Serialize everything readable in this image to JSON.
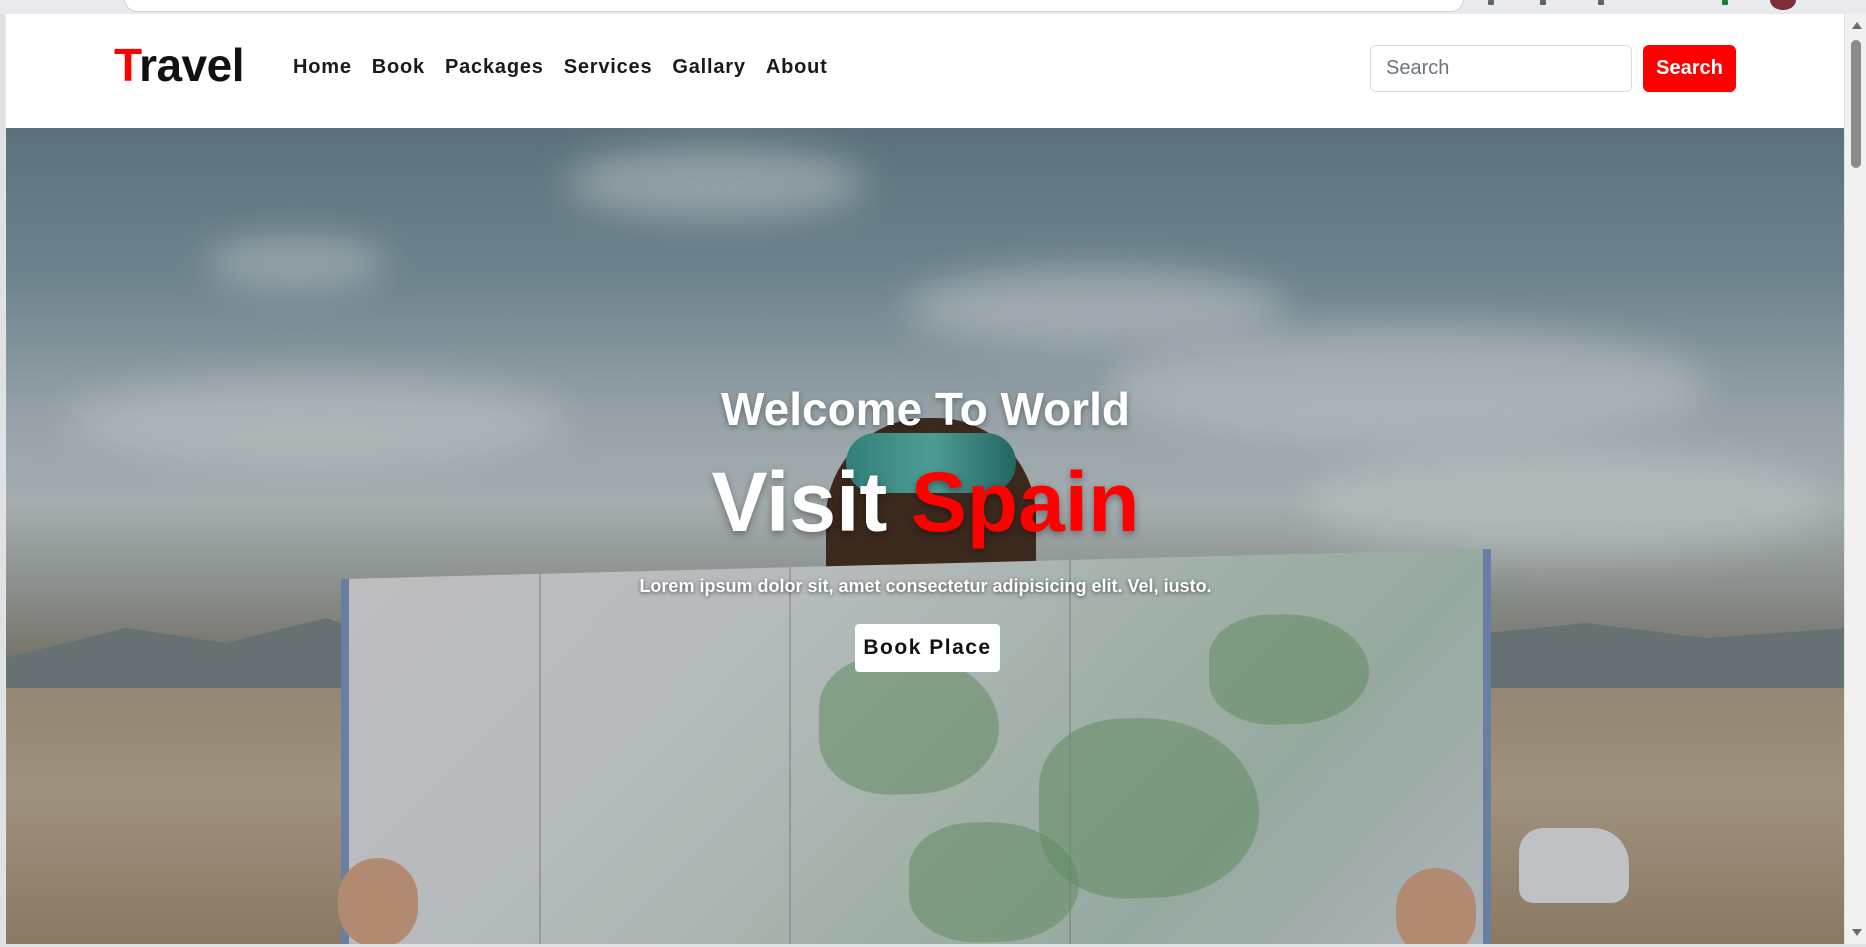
{
  "navbar": {
    "brand_first_letter": "T",
    "brand_rest": "ravel",
    "links": [
      "Home",
      "Book",
      "Packages",
      "Services",
      "Gallary",
      "About"
    ],
    "search": {
      "placeholder": "Search",
      "button_label": "Search"
    }
  },
  "hero": {
    "subtitle": "Welcome To World",
    "title_part1": "Visit ",
    "title_part2": "Spain",
    "text": "Lorem ipsum dolor sit, amet consectetur adipisicing elit. Vel, iusto.",
    "button_label": "Book Place"
  },
  "colors": {
    "accent": "#ff0000",
    "text_dark": "#1a1a1a",
    "background": "#ffffff"
  },
  "icons": [
    "scroll-up-arrow-icon",
    "scroll-down-arrow-icon"
  ]
}
